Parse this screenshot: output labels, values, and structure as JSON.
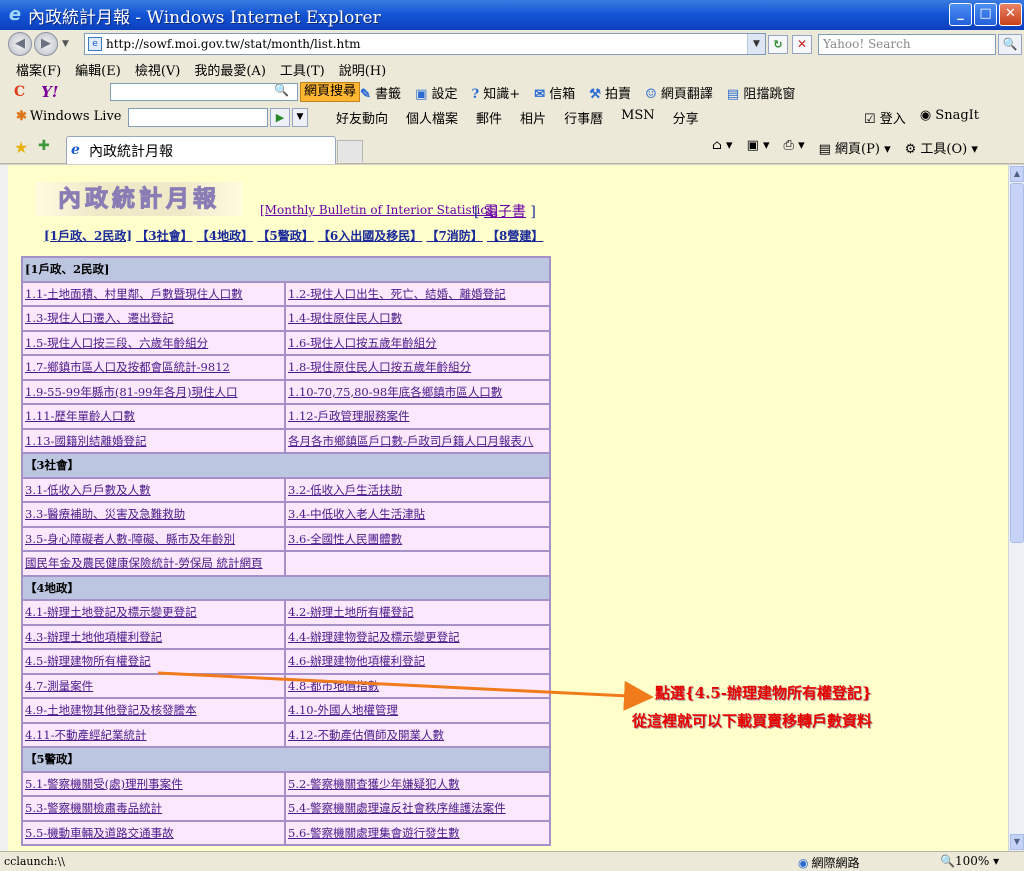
{
  "window": {
    "title": "內政統計月報 - Windows Internet Explorer"
  },
  "address_bar": {
    "url": "http://sowf.moi.gov.tw/stat/month/list.htm",
    "search_placeholder": "Yahoo! Search"
  },
  "menu": [
    "檔案(F)",
    "編輯(E)",
    "檢視(V)",
    "我的最愛(A)",
    "工具(T)",
    "說明(H)"
  ],
  "yahoo_toolbar": {
    "search_button": "網頁搜尋",
    "items": [
      "書籤",
      "設定",
      "知識+",
      "信箱",
      "拍賣",
      "網頁翻譯",
      "阻擋跳窗"
    ]
  },
  "wl_toolbar": {
    "logo": "Windows Live",
    "links": [
      "好友動向",
      "個人檔案",
      "郵件",
      "相片",
      "行事曆",
      "MSN",
      "分享"
    ],
    "login": "登入",
    "snagit": "SnagIt"
  },
  "tab": {
    "label": "內政統計月報"
  },
  "command_bar": {
    "page": "網頁(P)",
    "tools": "工具(O)"
  },
  "page": {
    "banner": "內政統計月報",
    "bulletin_link": "[Monthly Bulletin of Interior Statistics]",
    "ebook_open": "[",
    "ebook": "電子書",
    "ebook_close": "]",
    "nav": [
      "[1戶政、2民政]",
      "【3社會】",
      "【4地政】",
      "【5警政】",
      "【6入出國及移民】",
      "【7消防】",
      "【8營建】"
    ]
  },
  "table": {
    "sections": [
      {
        "title": "[1戶政、2民政]",
        "rows": [
          [
            "1.1-土地面積、村里鄰、戶數暨現住人口數",
            "1.2-現住人口出生、死亡、結婚、離婚登記"
          ],
          [
            "1.3-現住人口遷入、遷出登記",
            "1.4-現住原住民人口數"
          ],
          [
            "1.5-現住人口按三段、六歲年齡組分",
            "1.6-現住人口按五歲年齡組分"
          ],
          [
            "1.7-鄉鎮市區人口及按都會區統計-9812",
            "1.8-現住原住民人口按五歲年齡組分"
          ],
          [
            "1.9-55-99年縣市(81-99年各月)現住人口",
            "1.10-70,75,80-98年底各鄉鎮市區人口數"
          ],
          [
            "1.11-歷年單齡人口數",
            "1.12-戶政管理服務案件"
          ],
          [
            "1.13-國籍別結離婚登記",
            "各月各市鄉鎮區戶口數-戶政司戶籍人口月報表八"
          ]
        ]
      },
      {
        "title": "【3社會】",
        "rows": [
          [
            "3.1-低收入戶戶數及人數",
            "3.2-低收入戶生活扶助"
          ],
          [
            "3.3-醫療補助、災害及急難救助",
            "3.4-中低收入老人生活津貼"
          ],
          [
            "3.5-身心障礙者人數-障礙、縣市及年齡別",
            "3.6-全國性人民團體數"
          ],
          [
            "國民年金及農民健康保險統計-勞保局 統計網頁",
            ""
          ]
        ]
      },
      {
        "title": "【4地政】",
        "rows": [
          [
            "4.1-辦理土地登記及標示變更登記",
            "4.2-辦理土地所有權登記"
          ],
          [
            "4.3-辦理土地他項權利登記",
            "4.4-辦理建物登記及標示變更登記"
          ],
          [
            "4.5-辦理建物所有權登記",
            "4.6-辦理建物他項權利登記"
          ],
          [
            "4.7-測量案件",
            "4.8-都市地價指數"
          ],
          [
            "4.9-土地建物其他登記及核發謄本",
            "4.10-外國人地權管理"
          ],
          [
            "4.11-不動產經紀業統計",
            "4.12-不動產估價師及開業人數"
          ]
        ]
      },
      {
        "title": "【5警政】",
        "rows": [
          [
            "5.1-警察機關受(處)理刑事案件",
            "5.2-警察機關查獲少年嫌疑犯人數"
          ],
          [
            "5.3-警察機關檢肅毒品統計",
            "5.4-警察機關處理違反社會秩序維護法案件"
          ],
          [
            "5.5-機動車輛及道路交通事故",
            "5.6-警察機關處理集會遊行發生數"
          ]
        ]
      }
    ]
  },
  "annotation": {
    "line1": "點選{4.5-辦理建物所有權登記}",
    "line2": "從這裡就可以下載買賣移轉戶數資料",
    "color": "#e80000",
    "arrow_color": "#f07b1a"
  },
  "status_bar": {
    "text": "cclaunch:\\\\",
    "zone": "網際網路",
    "zoom": "100%"
  }
}
